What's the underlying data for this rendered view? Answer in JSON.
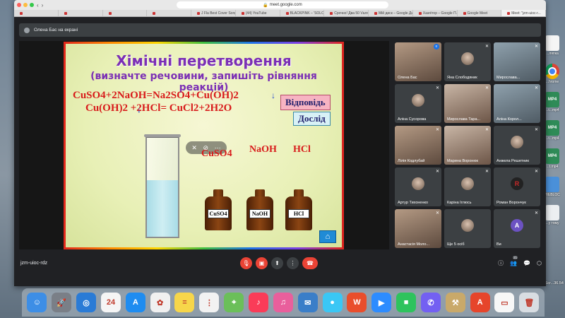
{
  "browser": {
    "url": "meet.google.com",
    "tabs": [
      "",
      "",
      "",
      "",
      "J Fla Best Cover Song...",
      "(44) YouTube",
      "BLACKPINK – 'SOLO'...",
      "Срочно! Два 50 Vаля...",
      "Мій диск – Google Ди...",
      "Хазяїтор – Google П...",
      "Google Meet",
      "Meet: \"jzm-uioc-r..."
    ]
  },
  "meet": {
    "presenting_banner": "Олена Бас на екрані",
    "meeting_code": "jzm-uioc-rdz",
    "participants_badge": "21"
  },
  "slide": {
    "title": "Хімічні перетворення",
    "subtitle": "(визначте речовини, запишіть рівняння реакцій)",
    "equation1": "CuSO4+2NaOH=Na2SO4+Cu(OH)2",
    "equation2": "Cu(OH)2 +2HCl= CuCl2+2H2O",
    "answer_button": "Відповідь",
    "experiment_button": "Дослід",
    "reagents": [
      {
        "label": "CuSO4",
        "tag": "CuSO4"
      },
      {
        "label": "NaOH",
        "tag": "NaOH"
      },
      {
        "label": "HCl",
        "tag": "HCl"
      }
    ]
  },
  "participants": [
    {
      "name": "Олена Бас",
      "type": "video",
      "status": "speaking"
    },
    {
      "name": "Яна Слободяник",
      "type": "avatar",
      "status": "muted"
    },
    {
      "name": "Мирослава...",
      "type": "video",
      "status": "muted"
    },
    {
      "name": "Аліна Сусорова",
      "type": "avatar",
      "status": "muted"
    },
    {
      "name": "Мирослава Тара...",
      "type": "video",
      "status": "muted"
    },
    {
      "name": "Аліна Корол...",
      "type": "video",
      "status": "muted"
    },
    {
      "name": "Лілія Кодлубай",
      "type": "video",
      "status": "muted"
    },
    {
      "name": "Марина Воронюк",
      "type": "video",
      "status": "muted"
    },
    {
      "name": "Анжела Решетник",
      "type": "avatar",
      "status": "muted"
    },
    {
      "name": "Артур Тихоненко",
      "type": "avatar",
      "status": "muted"
    },
    {
      "name": "Каріна Іглюсь",
      "type": "avatar",
      "status": "muted"
    },
    {
      "name": "Роман Ворончук",
      "type": "avatar",
      "initial": "R",
      "status": "muted"
    },
    {
      "name": "Анастасія Моло...",
      "type": "video",
      "status": "muted"
    },
    {
      "name": "Ще 5 осіб",
      "type": "avatar",
      "status": ""
    },
    {
      "name": "Ви",
      "type": "avatar",
      "initial": "A",
      "status": "muted"
    }
  ],
  "desktop_icons": [
    {
      "label": "...ляпка",
      "kind": "file"
    },
    {
      "label": "...hrome",
      "kind": "chrome"
    },
    {
      "label": "...t...mp4",
      "kind": "mp4"
    },
    {
      "label": "...t...mp4",
      "kind": "mp4"
    },
    {
      "label": "...t.mp4",
      "kind": "mp4"
    },
    {
      "label": "WEBLOC",
      "kind": "folder"
    },
    {
      "label": "...у тому",
      "kind": "doc"
    }
  ],
  "desktop_screenshot_label": "LWScr...36.54",
  "dock_apps": [
    {
      "name": "Finder",
      "color": "#3d8ee6",
      "glyph": "☺"
    },
    {
      "name": "Launchpad",
      "color": "#7a7f87",
      "glyph": "🚀"
    },
    {
      "name": "Safari",
      "color": "#2a7bd6",
      "glyph": "◎"
    },
    {
      "name": "Calendar",
      "color": "#f5f5f5",
      "glyph": "24"
    },
    {
      "name": "App Store",
      "color": "#1e8cf0",
      "glyph": "A"
    },
    {
      "name": "Photos",
      "color": "#f0f0f0",
      "glyph": "✿"
    },
    {
      "name": "Notes",
      "color": "#f7d64a",
      "glyph": "≡"
    },
    {
      "name": "Reminders",
      "color": "#f2f2f2",
      "glyph": "⋮"
    },
    {
      "name": "Maps",
      "color": "#6bbf59",
      "glyph": "⌖"
    },
    {
      "name": "Music",
      "color": "#fa3c58",
      "glyph": "♪"
    },
    {
      "name": "iTunes",
      "color": "#e95f9c",
      "glyph": "♫"
    },
    {
      "name": "Preview",
      "color": "#3a7ec8",
      "glyph": "✉"
    },
    {
      "name": "Messages",
      "color": "#3ac7f5",
      "glyph": "●"
    },
    {
      "name": "Office",
      "color": "#e94e2c",
      "glyph": "W"
    },
    {
      "name": "Zoom",
      "color": "#2d8cff",
      "glyph": "▶"
    },
    {
      "name": "FaceTime",
      "color": "#2ec35d",
      "glyph": "■"
    },
    {
      "name": "Viber",
      "color": "#7360f2",
      "glyph": "✆"
    },
    {
      "name": "Toolbox",
      "color": "#c9a96a",
      "glyph": "⚒"
    },
    {
      "name": "Acrobat",
      "color": "#e6452b",
      "glyph": "A"
    },
    {
      "name": "Finder Window",
      "color": "#f7f7f7",
      "glyph": "▭"
    },
    {
      "name": "Trash",
      "color": "#d8dde2",
      "glyph": "🗑"
    }
  ],
  "colors": {
    "meet_bg": "#202124",
    "slide_title": "#7b2fb5",
    "equation": "#d81b1b",
    "end_call": "#ea4335"
  }
}
